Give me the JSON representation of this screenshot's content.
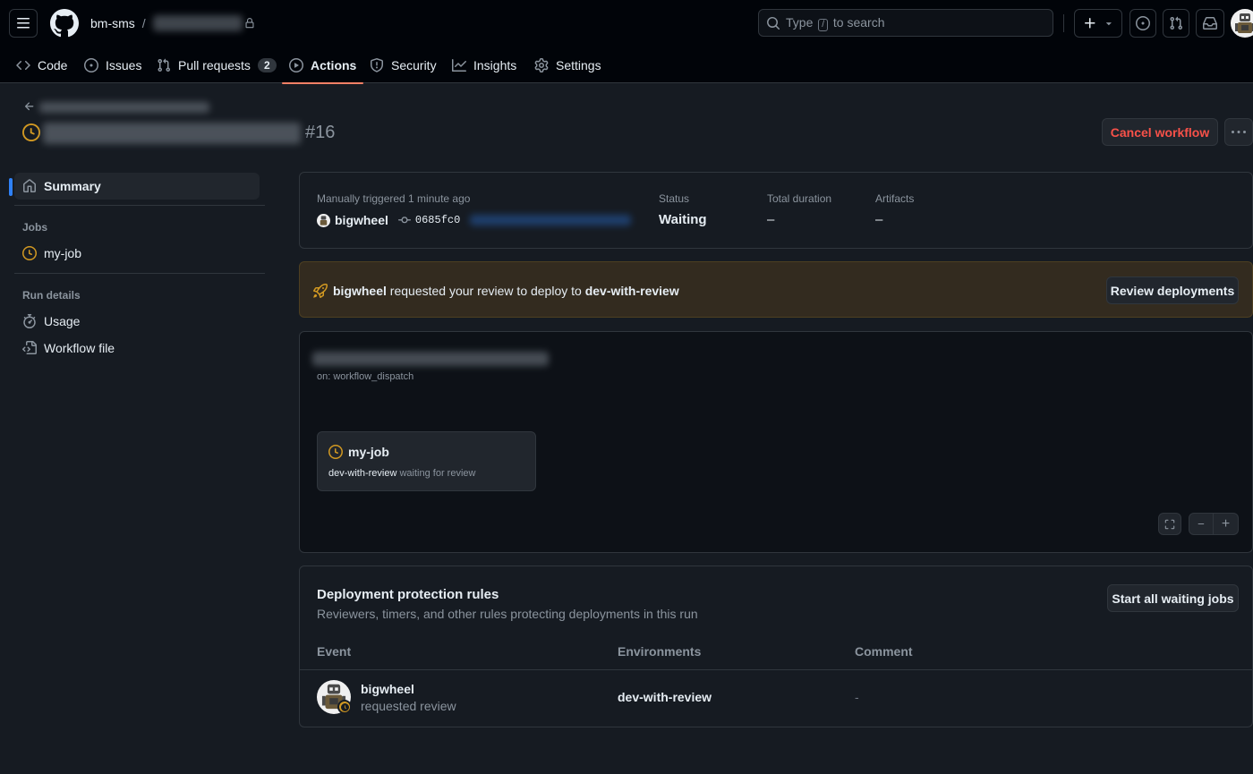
{
  "header": {
    "owner": "bm-sms",
    "separator": "/",
    "search_text_before": "Type",
    "search_key": "/",
    "search_text_after": "to search"
  },
  "repo_nav": {
    "tabs": [
      {
        "label": "Code",
        "icon": "code-icon"
      },
      {
        "label": "Issues",
        "icon": "issue-opened-icon"
      },
      {
        "label": "Pull requests",
        "icon": "git-pull-request-icon",
        "counter": "2"
      },
      {
        "label": "Actions",
        "icon": "play-icon",
        "selected": true
      },
      {
        "label": "Security",
        "icon": "shield-icon"
      },
      {
        "label": "Insights",
        "icon": "graph-icon"
      },
      {
        "label": "Settings",
        "icon": "gear-icon"
      }
    ]
  },
  "run": {
    "number": "#16",
    "cancel_label": "Cancel workflow"
  },
  "sidebar": {
    "summary_label": "Summary",
    "jobs_heading": "Jobs",
    "job_label": "my-job",
    "run_details_heading": "Run details",
    "usage_label": "Usage",
    "workflow_file_label": "Workflow file"
  },
  "summary": {
    "trigger_label": "Manually triggered 1 minute ago",
    "actor": "bigwheel",
    "commit": "0685fc0",
    "status_label": "Status",
    "status_value": "Waiting",
    "duration_label": "Total duration",
    "duration_value": "–",
    "artifacts_label": "Artifacts",
    "artifacts_value": "–"
  },
  "review_banner": {
    "actor": "bigwheel",
    "text": "requested your review to deploy to",
    "environment": "dev-with-review",
    "button_label": "Review deployments"
  },
  "graph": {
    "trigger": "on: workflow_dispatch",
    "job_name": "my-job",
    "job_env": "dev-with-review",
    "job_status": "waiting for review",
    "zoom_out": "−",
    "zoom_in": "+"
  },
  "protection_rules": {
    "title": "Deployment protection rules",
    "subtitle": "Reviewers, timers, and other rules protecting deployments in this run",
    "button_label": "Start all waiting jobs",
    "columns": [
      "Event",
      "Environments",
      "Comment"
    ],
    "rows": [
      {
        "user": "bigwheel",
        "action": "requested review",
        "environment": "dev-with-review",
        "comment": "-"
      }
    ]
  },
  "colors": {
    "accent_orange": "#f78166",
    "waiting_yellow": "#d29922",
    "danger_red": "#f85149",
    "active_blue": "#2f81f7"
  }
}
